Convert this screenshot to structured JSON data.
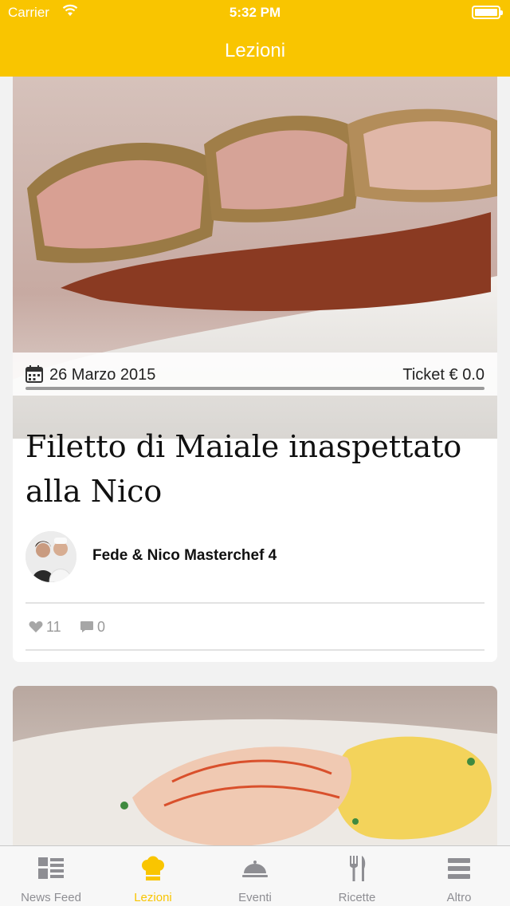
{
  "status_bar": {
    "carrier": "Carrier",
    "time": "5:32 PM"
  },
  "nav": {
    "title": "Lezioni"
  },
  "colors": {
    "accent": "#f9c500",
    "tab_inactive": "#8e8e93"
  },
  "feed": {
    "cards": [
      {
        "date": "26 Marzo 2015",
        "ticket": "Ticket € 0.0",
        "title": "Filetto di Maiale inaspettato alla Nico",
        "author": "Fede & Nico Masterchef 4",
        "likes": "11",
        "comments": "0"
      }
    ]
  },
  "tabs": [
    {
      "label": "News Feed",
      "icon": "news-feed-icon",
      "active": false
    },
    {
      "label": "Lezioni",
      "icon": "chef-hat-icon",
      "active": true
    },
    {
      "label": "Eventi",
      "icon": "cloche-icon",
      "active": false
    },
    {
      "label": "Ricette",
      "icon": "fork-knife-icon",
      "active": false
    },
    {
      "label": "Altro",
      "icon": "menu-icon",
      "active": false
    }
  ]
}
